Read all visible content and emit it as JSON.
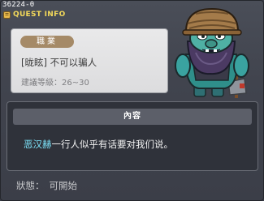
{
  "quest_id": "36224-0",
  "window": {
    "title": "QUEST INFO",
    "title_color": "#f3d95a"
  },
  "quest": {
    "job_label": "職業",
    "name": "[昽眩] 不可以骗人",
    "level_label": "建議等級",
    "level_range": "：26~30"
  },
  "content": {
    "header": "內容",
    "npc_name": "恶汉赫",
    "text": "一行人似乎有话要对我们说。",
    "npc_name_color": "#7ee8ff"
  },
  "status": {
    "label": "狀態：",
    "value": "可開始"
  },
  "icons": {
    "title_icon": "quest-book-icon",
    "npc_portrait": "bearded-guard-npc"
  }
}
